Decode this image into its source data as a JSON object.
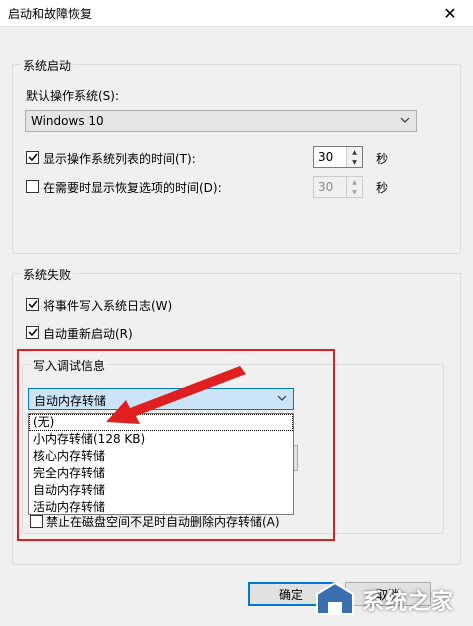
{
  "window": {
    "title": "启动和故障恢复",
    "close_glyph": "✕"
  },
  "system_startup": {
    "group_label": "系统启动",
    "default_os_label": "默认操作系统(S):",
    "default_os_value": "Windows 10",
    "show_os_list": {
      "label": "显示操作系统列表的时间(T):",
      "checked": true,
      "value": "30",
      "unit": "秒"
    },
    "show_recovery": {
      "label": "在需要时显示恢复选项的时间(D):",
      "checked": false,
      "value": "30",
      "unit": "秒"
    }
  },
  "system_failure": {
    "group_label": "系统失败",
    "write_event_log": {
      "label": "将事件写入系统日志(W)",
      "checked": true
    },
    "auto_restart": {
      "label": "自动重新启动(R)",
      "checked": true
    }
  },
  "debug_info": {
    "group_label": "写入调试信息",
    "selected_value": "自动内存转储",
    "options": [
      "(无)",
      "小内存转储(128 KB)",
      "核心内存转储",
      "完全内存转储",
      "自动内存转储",
      "活动内存转储"
    ],
    "highlighted_option": "(无)",
    "disable_auto_delete": {
      "label": "禁止在磁盘空间不足时自动删除内存转储(A)",
      "checked": false
    }
  },
  "buttons": {
    "ok": "确定",
    "cancel": "取消"
  },
  "watermark": {
    "text": "系统之家"
  },
  "colors": {
    "annotation_red": "#e02020",
    "focus_blue": "#0078d7",
    "combo_focus_bg": "#cce4f7"
  }
}
